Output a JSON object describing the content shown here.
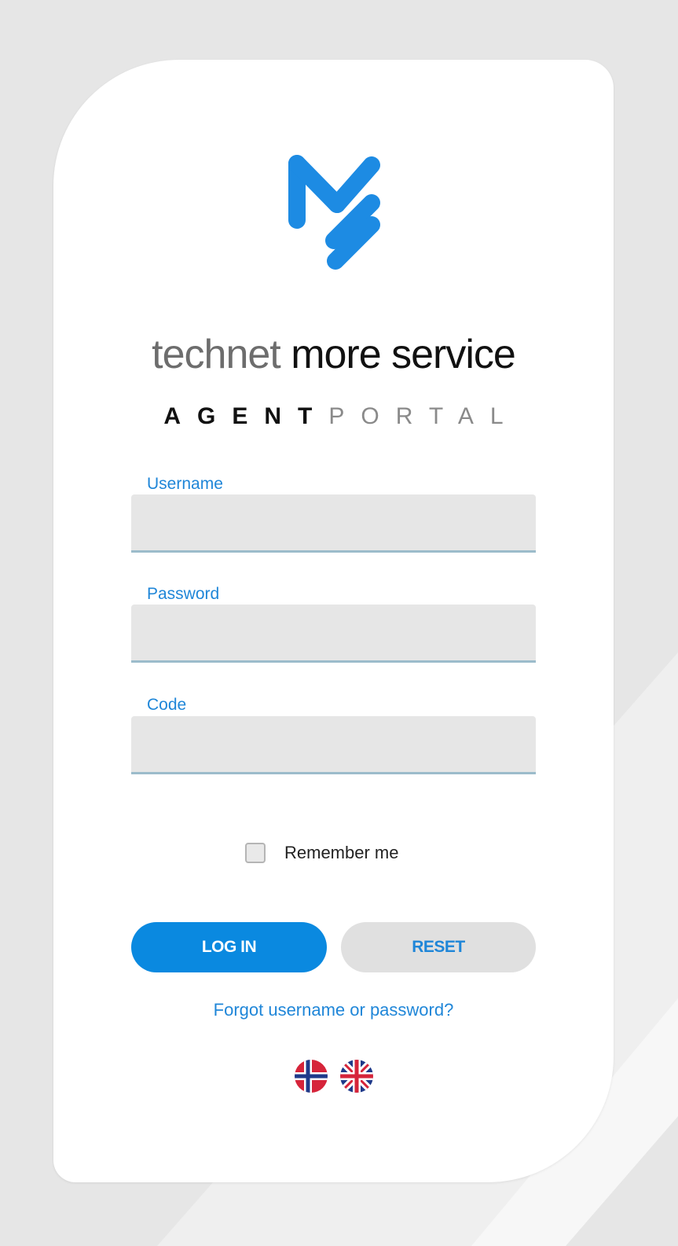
{
  "brand": {
    "title_light": "technet",
    "title_dark": "more service",
    "subtitle_bold": "AGENT",
    "subtitle_light": "PORTAL",
    "logo_icon": "mt-logo-icon",
    "accent_color": "#1f86d8"
  },
  "form": {
    "username_label": "Username",
    "username_value": "",
    "password_label": "Password",
    "password_value": "",
    "code_label": "Code",
    "code_value": "",
    "remember_label": "Remember me",
    "remember_checked": false
  },
  "buttons": {
    "login_label": "LOG IN",
    "reset_label": "RESET"
  },
  "links": {
    "forgot_label": "Forgot username or password?"
  },
  "languages": [
    {
      "icon": "norway-flag-icon"
    },
    {
      "icon": "uk-flag-icon"
    }
  ]
}
